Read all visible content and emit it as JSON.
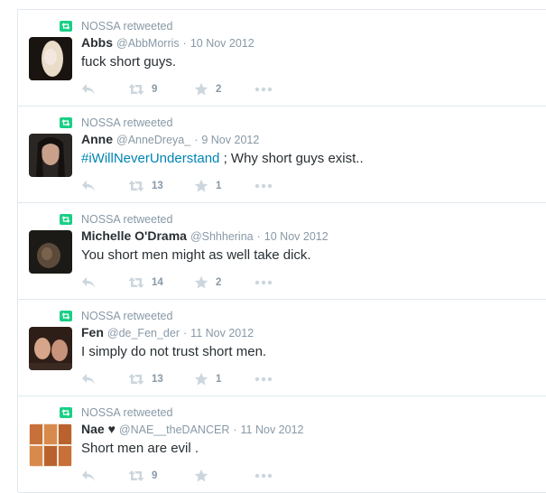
{
  "feed": {
    "tweets": [
      {
        "retweeted_by": "NOSSA retweeted",
        "name": "Abbs",
        "handle": "@AbbMorris",
        "date": "10 Nov 2012",
        "hashtag": "",
        "text": "fuck short guys.",
        "retweets": "9",
        "favorites": "2",
        "avatar_colors": [
          "#1a1410",
          "#e9dcc8"
        ]
      },
      {
        "retweeted_by": "NOSSA retweeted",
        "name": "Anne",
        "handle": "@AnneDreya_",
        "date": "9 Nov 2012",
        "hashtag": "#iWillNeverUnderstand",
        "text": " ; Why short guys exist..",
        "retweets": "13",
        "favorites": "1",
        "avatar_colors": [
          "#2a2624",
          "#c9a08a"
        ]
      },
      {
        "retweeted_by": "NOSSA retweeted",
        "name": "Michelle O'Drama",
        "handle": "@Shhherina",
        "date": "10 Nov 2012",
        "hashtag": "",
        "text": "You short men might as well take dick.",
        "retweets": "14",
        "favorites": "2",
        "avatar_colors": [
          "#1b1a16",
          "#5b4a3a"
        ]
      },
      {
        "retweeted_by": "NOSSA retweeted",
        "name": "Fen",
        "handle": "@de_Fen_der",
        "date": "11 Nov 2012",
        "hashtag": "",
        "text": "I simply do not trust short men.",
        "retweets": "13",
        "favorites": "1",
        "avatar_colors": [
          "#2e1e18",
          "#d7a58a"
        ]
      },
      {
        "retweeted_by": "NOSSA retweeted",
        "name": "Nae ♥",
        "handle": "@NAE__theDANCER",
        "date": "11 Nov 2012",
        "hashtag": "",
        "text": "Short men are evil .",
        "retweets": "9",
        "favorites": "",
        "avatar_colors": [
          "#f3e6d6",
          "#c8703a"
        ]
      }
    ],
    "separator": "·"
  },
  "colors": {
    "retweet_badge": "#19cf86",
    "muted_text": "#8899a6",
    "body_text": "#292f33",
    "hashtag": "#0084b4",
    "action_icon": "#ccd6dd"
  },
  "icons": [
    "retweet-badge-icon",
    "reply-icon",
    "retweet-icon",
    "favorite-star-icon",
    "more-dots-icon"
  ]
}
